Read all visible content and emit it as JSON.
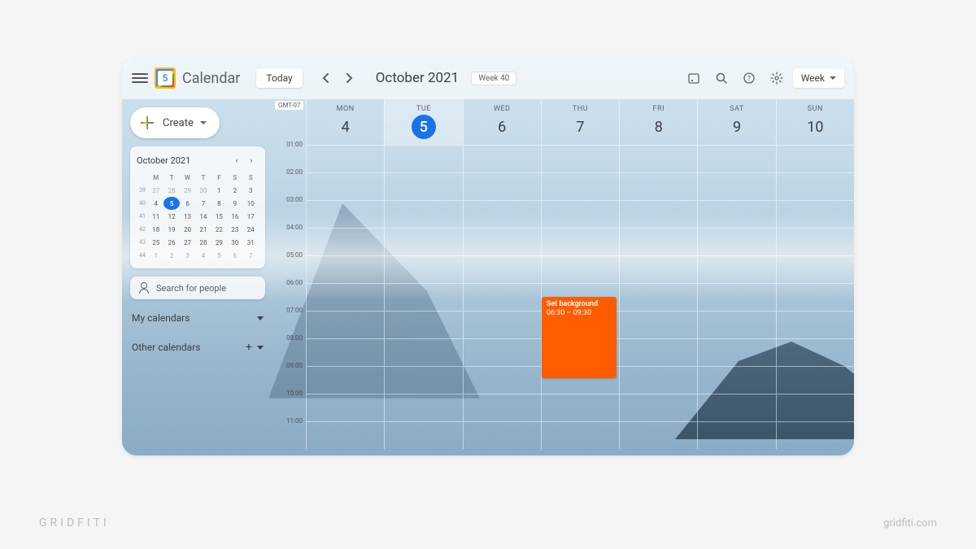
{
  "app": {
    "title": "Calendar",
    "logo_day": "5"
  },
  "header": {
    "today_label": "Today",
    "month_title": "October 2021",
    "week_chip": "Week 40",
    "view_label": "Week"
  },
  "sidebar": {
    "create_label": "Create",
    "minical": {
      "title": "October 2021",
      "dow": [
        "M",
        "T",
        "W",
        "T",
        "F",
        "S",
        "S"
      ],
      "weeks": [
        {
          "wk": "39",
          "days": [
            {
              "n": "27",
              "dim": true
            },
            {
              "n": "28",
              "dim": true
            },
            {
              "n": "29",
              "dim": true
            },
            {
              "n": "30",
              "dim": true
            },
            {
              "n": "1"
            },
            {
              "n": "2"
            },
            {
              "n": "3"
            }
          ]
        },
        {
          "wk": "40",
          "days": [
            {
              "n": "4"
            },
            {
              "n": "5",
              "today": true
            },
            {
              "n": "6"
            },
            {
              "n": "7"
            },
            {
              "n": "8"
            },
            {
              "n": "9"
            },
            {
              "n": "10"
            }
          ]
        },
        {
          "wk": "41",
          "days": [
            {
              "n": "11"
            },
            {
              "n": "12"
            },
            {
              "n": "13"
            },
            {
              "n": "14"
            },
            {
              "n": "15"
            },
            {
              "n": "16"
            },
            {
              "n": "17"
            }
          ]
        },
        {
          "wk": "42",
          "days": [
            {
              "n": "18"
            },
            {
              "n": "19"
            },
            {
              "n": "20"
            },
            {
              "n": "21"
            },
            {
              "n": "22"
            },
            {
              "n": "23"
            },
            {
              "n": "24"
            }
          ]
        },
        {
          "wk": "43",
          "days": [
            {
              "n": "25"
            },
            {
              "n": "26"
            },
            {
              "n": "27"
            },
            {
              "n": "28"
            },
            {
              "n": "29"
            },
            {
              "n": "30"
            },
            {
              "n": "31"
            }
          ]
        },
        {
          "wk": "44",
          "days": [
            {
              "n": "1",
              "dim": true
            },
            {
              "n": "2",
              "dim": true
            },
            {
              "n": "3",
              "dim": true
            },
            {
              "n": "4",
              "dim": true
            },
            {
              "n": "5",
              "dim": true
            },
            {
              "n": "6",
              "dim": true
            },
            {
              "n": "7",
              "dim": true
            }
          ]
        }
      ]
    },
    "search_people": "Search for people",
    "my_calendars": "My calendars",
    "other_calendars": "Other calendars"
  },
  "grid": {
    "gmt": "GMT-07",
    "days": [
      {
        "dow": "MON",
        "num": "4"
      },
      {
        "dow": "TUE",
        "num": "5",
        "today": true
      },
      {
        "dow": "WED",
        "num": "6"
      },
      {
        "dow": "THU",
        "num": "7"
      },
      {
        "dow": "FRI",
        "num": "8"
      },
      {
        "dow": "SAT",
        "num": "9"
      },
      {
        "dow": "SUN",
        "num": "10"
      }
    ],
    "hours": [
      "01:00",
      "02:00",
      "03:00",
      "04:00",
      "05:00",
      "06:00",
      "07:00",
      "08:00",
      "09:00",
      "10:00",
      "11:00"
    ],
    "event": {
      "title": "Set background",
      "time": "06:30 – 09:30",
      "color": "#ff5c00",
      "day_index": 3,
      "start_row": 5.5,
      "end_row": 8.5
    }
  },
  "footer": {
    "left": "GRIDFITI",
    "right": "gridfiti.com"
  }
}
